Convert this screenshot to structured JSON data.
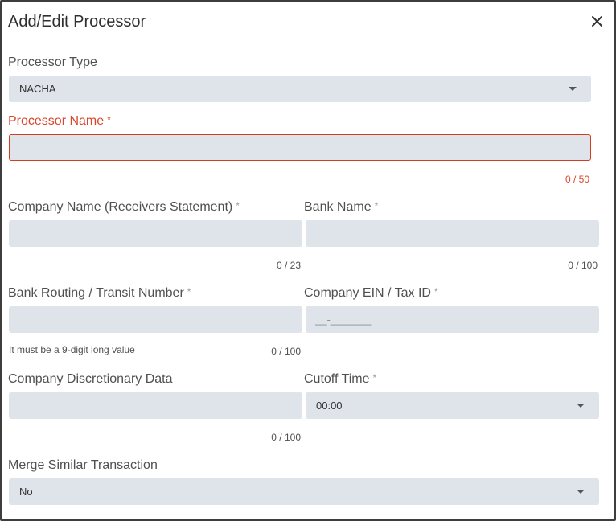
{
  "dialog": {
    "title": "Add/Edit Processor"
  },
  "processor_type": {
    "label": "Processor Type",
    "value": "NACHA"
  },
  "processor_name": {
    "label": "Processor Name",
    "required": "*",
    "value": "",
    "counter": "0 / 50"
  },
  "company_name": {
    "label": "Company Name (Receivers Statement)",
    "required": "*",
    "value": "",
    "counter": "0 / 23"
  },
  "bank_name": {
    "label": "Bank Name",
    "required": "*",
    "value": "",
    "counter": "0 / 100"
  },
  "bank_routing": {
    "label": "Bank Routing / Transit Number",
    "required": "*",
    "value": "",
    "hint": "It must be a 9-digit long value",
    "counter": "0 / 100"
  },
  "company_ein": {
    "label": "Company EIN / Tax ID",
    "required": "*",
    "placeholder": "__-_______"
  },
  "discretionary": {
    "label": "Company Discretionary Data",
    "value": "",
    "counter": "0 / 100"
  },
  "cutoff_time": {
    "label": "Cutoff Time",
    "required": "*",
    "value": "00:00"
  },
  "merge_similar": {
    "label": "Merge Similar Transaction",
    "value": "No"
  },
  "colors": {
    "error": "#d9472b",
    "field_bg": "#dfe3ea",
    "border": "#3d3d3d"
  },
  "icons": {
    "close": "close-icon",
    "dropdown": "chevron-down-icon"
  }
}
